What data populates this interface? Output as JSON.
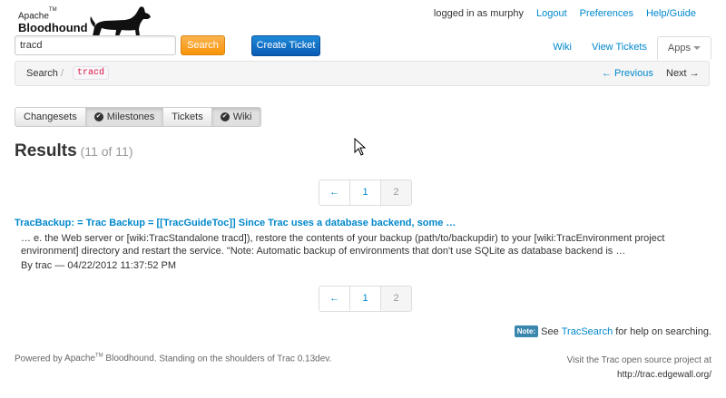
{
  "logo": {
    "line1": "Apache",
    "tm": "TM",
    "line2": "Bloodhound"
  },
  "topnav": {
    "logged_in": "logged in as  murphy",
    "logout": "Logout",
    "preferences": "Preferences",
    "help": "Help/Guide"
  },
  "search": {
    "value": "tracd",
    "button": "Search"
  },
  "create_ticket": "Create Ticket",
  "tabs": [
    {
      "label": "Wiki"
    },
    {
      "label": "View Tickets"
    },
    {
      "label": "Apps"
    }
  ],
  "breadcrumb": {
    "root": "Search",
    "sep": "/",
    "query": "tracd",
    "prev": "← Previous",
    "next": "Next →"
  },
  "filters": [
    {
      "label": "Changesets",
      "checked": false
    },
    {
      "label": "Milestones",
      "checked": true
    },
    {
      "label": "Tickets",
      "checked": false
    },
    {
      "label": "Wiki",
      "checked": true
    }
  ],
  "results": {
    "title": "Results",
    "count": "(11 of 11)"
  },
  "pager": {
    "prev": "←",
    "page1": "1",
    "page2": "2"
  },
  "result": {
    "title": "TracBackup: = Trac Backup = [[TracGuideToc]] Since Trac uses a database backend, some …",
    "excerpt": "… e. the Web server or [wiki:TracStandalone tracd]), restore the contents of your backup (path/to/backupdir) to your [wiki:TracEnvironment project environment] directory and restart the service. \"Note: Automatic backup of environments that don't use SQLite as database backend is …",
    "meta": "By trac — 04/22/2012 11:37:52 PM"
  },
  "help": {
    "badge": "Note:",
    "pre": "See",
    "link": "TracSearch",
    "post": "for help on searching."
  },
  "footer": {
    "powered_pre": "Powered by",
    "apache": "Apache",
    "tm": "TM",
    "bloodhound": "Bloodhound",
    "shoulders": ". Standing on the shoulders of",
    "trac": "Trac 0.13dev",
    "dot": ".",
    "visit": "Visit the Trac open source project at",
    "url": "http://trac.edgewall.org/"
  }
}
